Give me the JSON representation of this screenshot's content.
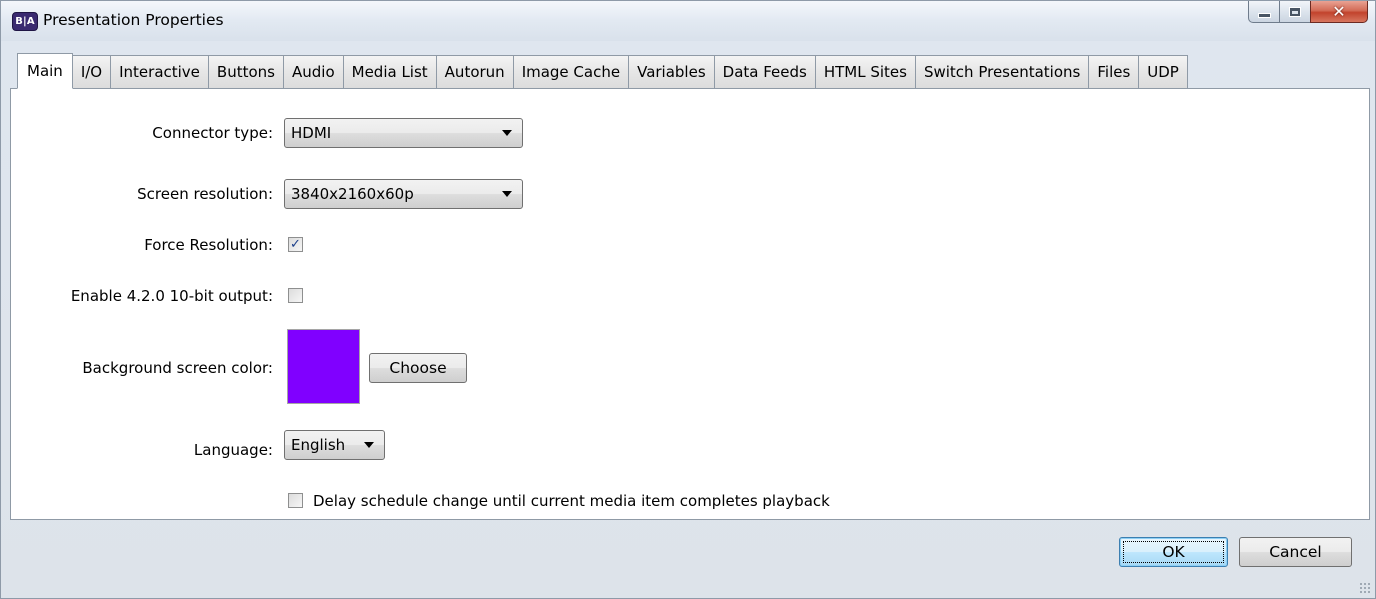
{
  "window": {
    "icon_text": "B|A",
    "title": "Presentation Properties"
  },
  "tabs": [
    {
      "label": "Main",
      "active": true
    },
    {
      "label": "I/O"
    },
    {
      "label": "Interactive"
    },
    {
      "label": "Buttons"
    },
    {
      "label": "Audio"
    },
    {
      "label": "Media List"
    },
    {
      "label": "Autorun"
    },
    {
      "label": "Image Cache"
    },
    {
      "label": "Variables"
    },
    {
      "label": "Data Feeds"
    },
    {
      "label": "HTML Sites"
    },
    {
      "label": "Switch Presentations"
    },
    {
      "label": "Files"
    },
    {
      "label": "UDP"
    }
  ],
  "main": {
    "connector_type": {
      "label": "Connector type:",
      "value": "HDMI"
    },
    "screen_resolution": {
      "label": "Screen resolution:",
      "value": "3840x2160x60p"
    },
    "force_resolution": {
      "label": "Force Resolution:",
      "checked": true
    },
    "enable_420": {
      "label": "Enable 4.2.0 10-bit output:",
      "checked": false
    },
    "background_color": {
      "label": "Background screen color:",
      "color": "#8000ff",
      "choose_label": "Choose"
    },
    "language": {
      "label": "Language:",
      "value": "English"
    },
    "delay_schedule": {
      "label": "Delay schedule change until current media item completes playback",
      "checked": false
    }
  },
  "footer": {
    "ok_label": "OK",
    "cancel_label": "Cancel"
  }
}
